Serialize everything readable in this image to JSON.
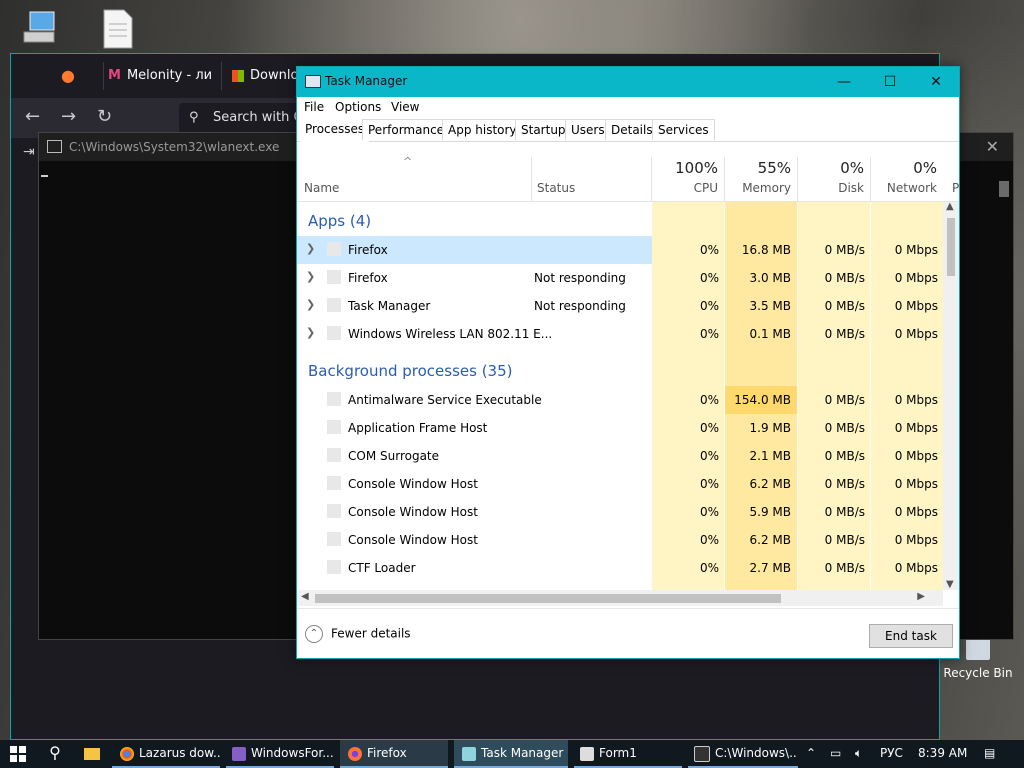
{
  "desktop": {
    "recycle_bin_label": "Recycle Bin"
  },
  "browser": {
    "tabs": [
      "Melonity - ли",
      "Downloac"
    ],
    "search_placeholder": "Search with G"
  },
  "console": {
    "title": "C:\\Windows\\System32\\wlanext.exe"
  },
  "task_manager": {
    "title": "Task Manager",
    "menu": [
      "File",
      "Options",
      "View"
    ],
    "tabs": [
      "Processes",
      "Performance",
      "App history",
      "Startup",
      "Users",
      "Details",
      "Services"
    ],
    "active_tab": "Processes",
    "columns": {
      "name": "Name",
      "status": "Status",
      "cpu": {
        "pct": "100%",
        "label": "CPU"
      },
      "memory": {
        "pct": "55%",
        "label": "Memory"
      },
      "disk": {
        "pct": "0%",
        "label": "Disk"
      },
      "network": {
        "pct": "0%",
        "label": "Network"
      },
      "power": "P"
    },
    "groups": {
      "apps": "Apps (4)",
      "background": "Background processes (35)"
    },
    "apps": [
      {
        "name": "Firefox",
        "status": "",
        "cpu": "0%",
        "memory": "16.8 MB",
        "disk": "0 MB/s",
        "network": "0 Mbps"
      },
      {
        "name": "Firefox",
        "status": "Not responding",
        "cpu": "0%",
        "memory": "3.0 MB",
        "disk": "0 MB/s",
        "network": "0 Mbps"
      },
      {
        "name": "Task Manager",
        "status": "Not responding",
        "cpu": "0%",
        "memory": "3.5 MB",
        "disk": "0 MB/s",
        "network": "0 Mbps"
      },
      {
        "name": "Windows Wireless LAN 802.11 E...",
        "status": "",
        "cpu": "0%",
        "memory": "0.1 MB",
        "disk": "0 MB/s",
        "network": "0 Mbps"
      }
    ],
    "background": [
      {
        "name": "Antimalware Service Executable",
        "cpu": "0%",
        "memory": "154.0 MB",
        "disk": "0 MB/s",
        "network": "0 Mbps"
      },
      {
        "name": "Application Frame Host",
        "cpu": "0%",
        "memory": "1.9 MB",
        "disk": "0 MB/s",
        "network": "0 Mbps"
      },
      {
        "name": "COM Surrogate",
        "cpu": "0%",
        "memory": "2.1 MB",
        "disk": "0 MB/s",
        "network": "0 Mbps"
      },
      {
        "name": "Console Window Host",
        "cpu": "0%",
        "memory": "6.2 MB",
        "disk": "0 MB/s",
        "network": "0 Mbps"
      },
      {
        "name": "Console Window Host",
        "cpu": "0%",
        "memory": "5.9 MB",
        "disk": "0 MB/s",
        "network": "0 Mbps"
      },
      {
        "name": "Console Window Host",
        "cpu": "0%",
        "memory": "6.2 MB",
        "disk": "0 MB/s",
        "network": "0 Mbps"
      },
      {
        "name": "CTF Loader",
        "cpu": "0%",
        "memory": "2.7 MB",
        "disk": "0 MB/s",
        "network": "0 Mbps"
      }
    ],
    "fewer_details": "Fewer details",
    "end_task": "End task"
  },
  "taskbar": {
    "items": [
      {
        "label": "Lazarus dow...",
        "icon": "chrome-icon"
      },
      {
        "label": "WindowsFor...",
        "icon": "visual-studio-icon"
      },
      {
        "label": "Firefox",
        "icon": "firefox-icon"
      },
      {
        "label": "Task Manager",
        "icon": "task-manager-icon"
      },
      {
        "label": "Form1",
        "icon": "form-icon"
      },
      {
        "label": "C:\\Windows\\...",
        "icon": "console-icon"
      }
    ],
    "language": "РУС",
    "time": "8:39 AM"
  },
  "colors": {
    "accent": "#0ab7c8",
    "selection": "#cce8ff",
    "heat_light": "#fff4c4",
    "heat_mid": "#ffe9a0",
    "heat_strong": "#ffd86e",
    "group_text": "#2a5db0"
  }
}
